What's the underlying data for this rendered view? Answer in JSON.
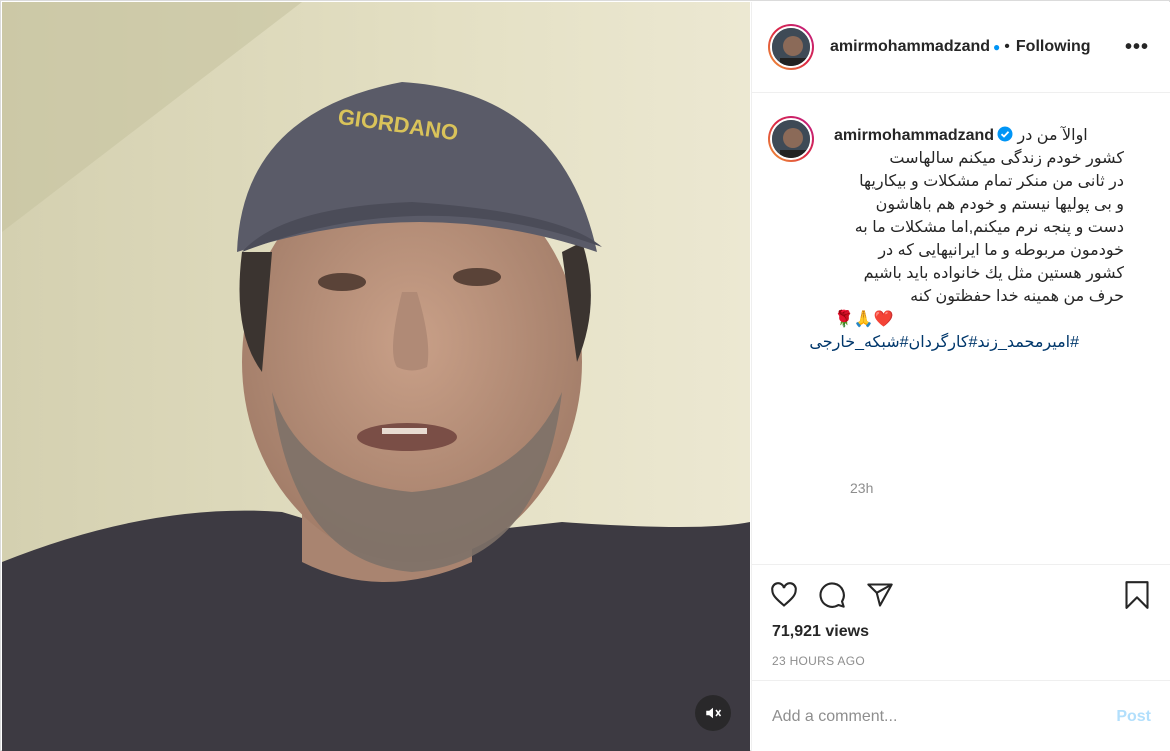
{
  "post": {
    "username": "amirmohammadzand",
    "follow_status": "Following",
    "more_label": "•••",
    "caption_lines": [
      "اوالآ من در",
      "کشور خودم زندگی میکنم سالهاست",
      "در ثانی من منکر تمام مشکلات و بیکاریها",
      "و بی پولیها نیستم و خودم هم باهاشون",
      "دست و پنجه نرم میکنم,اما مشکلات ما به",
      "خودمون مربوطه و ما ایرانیهایی که در",
      "کشور هستین مثل یك خانواده باید باشیم",
      "حرف من همینه خدا حفظتون کنه"
    ],
    "caption_emojis": "🌹🙏❤️",
    "hashtags": "#امیرمحمد_زند#کارگردان#شبکه_خارجی",
    "caption_time": "23h",
    "views": "71,921 views",
    "posted_ago": "23 HOURS AGO",
    "comment_placeholder": "Add a comment...",
    "post_label": "Post",
    "cap_word": "GIORDANO"
  },
  "icons": {
    "like": "heart-icon",
    "comment": "comment-icon",
    "share": "share-icon",
    "save": "bookmark-icon",
    "mute": "speaker-muted-icon",
    "verified": "verified-badge-icon"
  },
  "colors": {
    "link": "#00376b",
    "verified": "#0095f6",
    "post_disabled": "#b2dffc",
    "muted_text": "#8e8e8e"
  }
}
